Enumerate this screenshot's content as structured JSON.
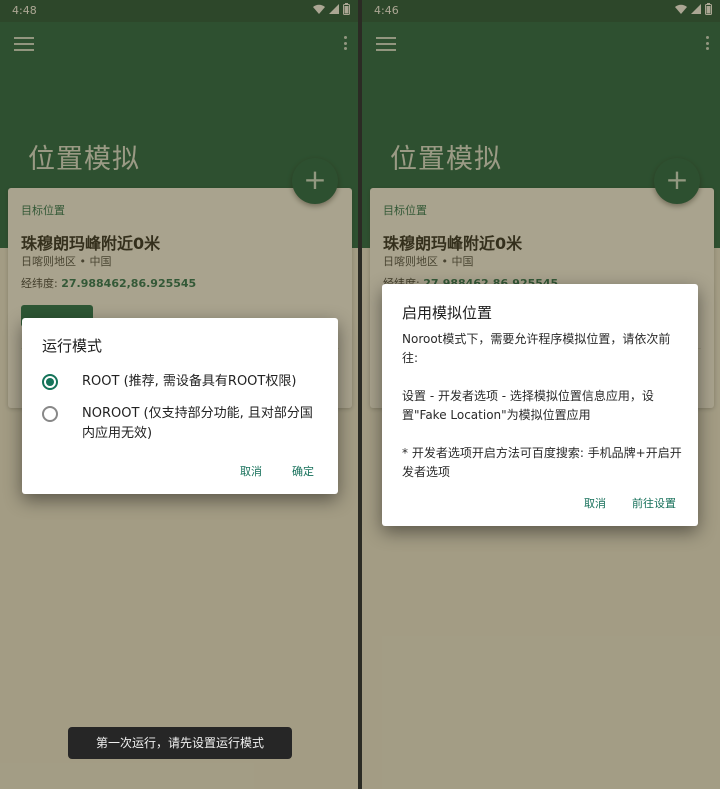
{
  "left_screen": {
    "status": {
      "time": "4:48"
    },
    "page_title": "位置模拟",
    "fab_symbol": "+",
    "card": {
      "label": "目标位置",
      "place": "珠穆朗玛峰附近0米",
      "region": "日喀则地区 • 中国",
      "coords_label": "经纬度:",
      "coords_value": "27.988462,86.925545"
    },
    "dialog": {
      "title": "运行模式",
      "options": [
        {
          "label": "ROOT (推荐, 需设备具有ROOT权限)",
          "checked": true
        },
        {
          "label": "NOROOT (仅支持部分功能, 且对部分国内应用无效)",
          "checked": false
        }
      ],
      "cancel": "取消",
      "confirm": "确定"
    },
    "toast": "第一次运行，请先设置运行模式"
  },
  "right_screen": {
    "status": {
      "time": "4:46"
    },
    "page_title": "位置模拟",
    "fab_symbol": "+",
    "card": {
      "label": "目标位置",
      "place": "珠穆朗玛峰附近0米",
      "region": "日喀则地区 • 中国",
      "coords_label": "经纬度:",
      "coords_value": "27.988462,86.925545"
    },
    "dialog": {
      "title": "启用模拟位置",
      "paragraphs": [
        "Noroot模式下，需要允许程序模拟位置，请依次前往:",
        "设置 - 开发者选项 - 选择模拟位置信息应用，设置\"Fake Location\"为模拟位置应用",
        "* 开发者选项开启方法可百度搜索: 手机品牌+开启开发者选项"
      ],
      "cancel": "取消",
      "confirm": "前往设置"
    }
  },
  "colors": {
    "appbar": "#105b42",
    "statusbar": "#0e4a36",
    "accent": "#15745a",
    "scrim": "rgba(80,70,30,0.48)"
  }
}
